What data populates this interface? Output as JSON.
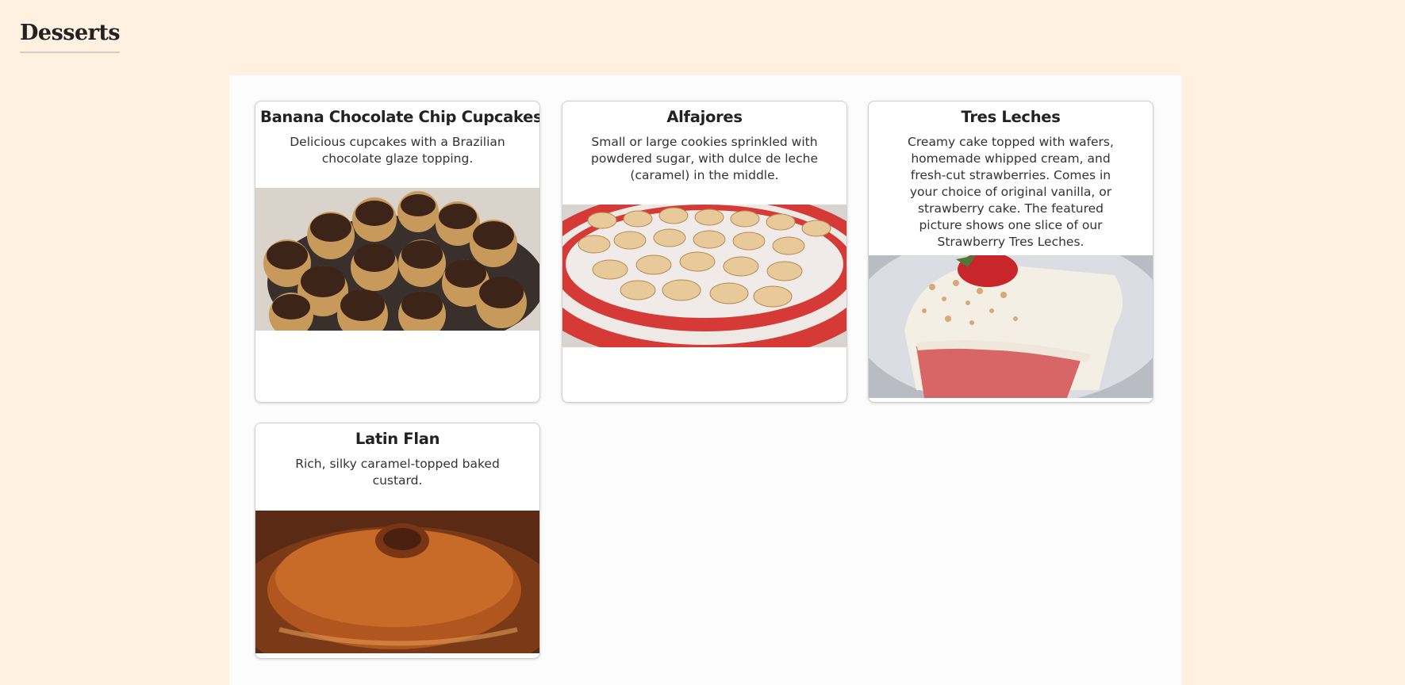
{
  "page": {
    "title": "Desserts"
  },
  "desserts": [
    {
      "title": "Banana Chocolate Chip Cupcakes",
      "description": "Delicious cupcakes with a Brazilian chocolate glaze topping.",
      "image": "banana-chocolate-chip-cupcakes-photo"
    },
    {
      "title": "Alfajores",
      "description": "Small or large cookies sprinkled with powdered sugar, with dulce de leche (caramel) in the middle.",
      "image": "alfajores-photo"
    },
    {
      "title": "Tres Leches",
      "description": "Creamy cake topped with wafers, homemade whipped cream, and fresh-cut strawberries. Comes in your choice of original vanilla, or strawberry cake. The featured picture shows one slice of our Strawberry Tres Leches.",
      "image": "tres-leches-photo"
    },
    {
      "title": "Latin Flan",
      "description": "Rich, silky caramel-topped baked custard.",
      "image": "latin-flan-photo"
    }
  ],
  "colors": {
    "page_background": "#fef1e2",
    "panel_background": "#fcfcfc",
    "card_background": "#ffffff",
    "card_border": "#cfcfcf"
  }
}
